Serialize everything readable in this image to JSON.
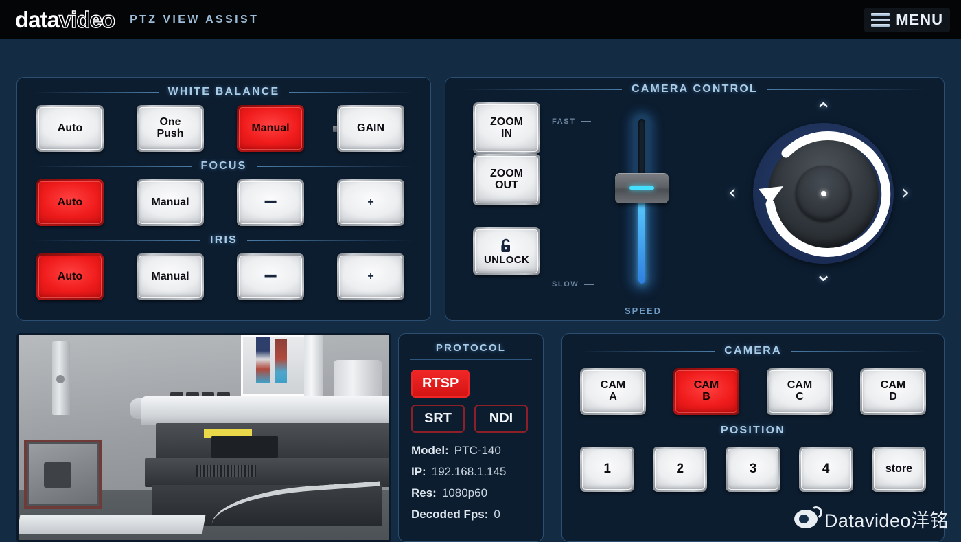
{
  "header": {
    "logo_data": "data",
    "logo_video": "video",
    "app_title": "PTZ VIEW ASSIST",
    "menu_label": "MENU",
    "menu_icon": "hamburger-icon"
  },
  "image_panel": {
    "white_balance": {
      "title": "WHITE BALANCE",
      "buttons": [
        {
          "label": "Auto",
          "active": false
        },
        {
          "label": "One\nPush",
          "active": false
        },
        {
          "label": "Manual",
          "active": true
        },
        {
          "label": "GAIN",
          "active": false
        }
      ]
    },
    "focus": {
      "title": "FOCUS",
      "buttons": [
        {
          "label": "Auto",
          "active": true
        },
        {
          "label": "Manual",
          "active": false
        },
        {
          "label": "−",
          "active": false
        },
        {
          "label": "+",
          "active": false
        }
      ]
    },
    "iris": {
      "title": "IRIS",
      "buttons": [
        {
          "label": "Auto",
          "active": true
        },
        {
          "label": "Manual",
          "active": false
        },
        {
          "label": "−",
          "active": false
        },
        {
          "label": "+",
          "active": false
        }
      ]
    }
  },
  "camera_control": {
    "title": "CAMERA CONTROL",
    "zoom_in": "ZOOM\nIN",
    "zoom_out": "ZOOM\nOUT",
    "unlock_label": "UNLOCK",
    "unlock_icon": "open-padlock-icon",
    "speed": {
      "caption": "SPEED",
      "fast_label": "FAST",
      "slow_label": "SLOW",
      "value_percent": 58
    },
    "joystick": {
      "rotate_icon": "rotate-ccw-icon",
      "up_icon": "chevron-up-icon",
      "down_icon": "chevron-down-icon",
      "left_icon": "chevron-left-icon",
      "right_icon": "chevron-right-icon",
      "up": "⌃",
      "down": "⌄",
      "left": "‹",
      "right": "›"
    }
  },
  "protocol": {
    "title": "PROTOCOL",
    "buttons": [
      {
        "label": "RTSP",
        "active": true
      },
      {
        "label": "SRT",
        "active": false
      },
      {
        "label": "NDI",
        "active": false
      }
    ],
    "info": [
      {
        "key": "Model:",
        "value": "PTC-140"
      },
      {
        "key": "IP:",
        "value": "192.168.1.145"
      },
      {
        "key": "Res:",
        "value": "1080p60"
      },
      {
        "key": "Decoded Fps:",
        "value": "0"
      }
    ]
  },
  "camera_panel": {
    "camera_title": "CAMERA",
    "cameras": [
      {
        "label": "CAM\nA",
        "active": false
      },
      {
        "label": "CAM\nB",
        "active": true
      },
      {
        "label": "CAM\nC",
        "active": false
      },
      {
        "label": "CAM\nD",
        "active": false
      }
    ],
    "position_title": "POSITION",
    "positions": [
      {
        "label": "1"
      },
      {
        "label": "2"
      },
      {
        "label": "3"
      },
      {
        "label": "4"
      },
      {
        "label": "store"
      }
    ]
  },
  "watermark": {
    "icon": "weibo-icon",
    "text": "Datavideo洋铭"
  },
  "colors": {
    "accent_red": "#f02626",
    "panel_bg": "#0c1d30",
    "page_bg": "#132c44",
    "header_bg": "#030507",
    "title_blue": "#a8cbe8",
    "slider_blue": "#45e0ff"
  }
}
